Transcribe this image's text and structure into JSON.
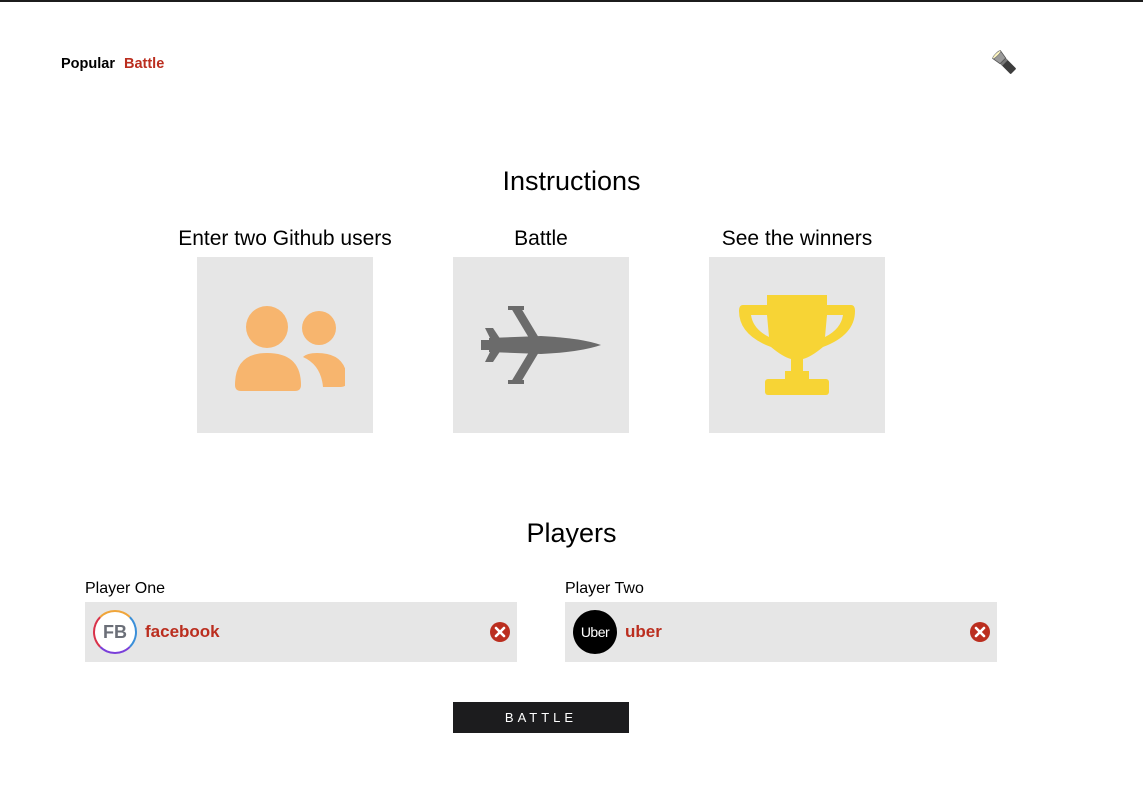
{
  "nav": {
    "items": [
      {
        "label": "Popular",
        "active": false
      },
      {
        "label": "Battle",
        "active": true
      }
    ]
  },
  "theme_toggle": {
    "icon": "flashlight-icon"
  },
  "instructions": {
    "title": "Instructions",
    "steps": [
      {
        "label": "Enter two Github users",
        "icon": "users-icon",
        "color": "#f7b56e"
      },
      {
        "label": "Battle",
        "icon": "fighter-jet-icon",
        "color": "#6b6b6b"
      },
      {
        "label": "See the winners",
        "icon": "trophy-icon",
        "color": "#f7d435"
      }
    ]
  },
  "players": {
    "title": "Players",
    "one": {
      "label": "Player One",
      "username": "facebook",
      "avatar_text": "FB"
    },
    "two": {
      "label": "Player Two",
      "username": "uber",
      "avatar_text": "Uber"
    }
  },
  "battle_button": {
    "label": "BATTLE"
  },
  "colors": {
    "accent": "#bb2e1f",
    "card_bg": "#e6e6e6",
    "button_bg": "#1c1c1e"
  }
}
